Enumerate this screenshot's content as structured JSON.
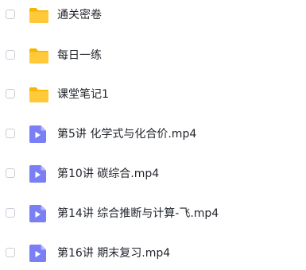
{
  "files": [
    {
      "name": "通关密卷",
      "type": "folder",
      "icon": "folder-icon"
    },
    {
      "name": "每日一练",
      "type": "folder",
      "icon": "folder-icon"
    },
    {
      "name": "课堂笔记1",
      "type": "folder",
      "icon": "folder-icon"
    },
    {
      "name": "第5讲 化学式与化合价.mp4",
      "type": "video",
      "icon": "video-file-icon"
    },
    {
      "name": "第10讲 碳综合.mp4",
      "type": "video",
      "icon": "video-file-icon"
    },
    {
      "name": "第14讲 综合推断与计算-飞.mp4",
      "type": "video",
      "icon": "video-file-icon"
    },
    {
      "name": "第16讲 期末复习.mp4",
      "type": "video",
      "icon": "video-file-icon"
    }
  ],
  "colors": {
    "folder": "#ffc93a",
    "folder_tab": "#f7b500",
    "video_file": "#7b7ff5",
    "video_fold": "#b8baf9",
    "text": "#1f2329",
    "checkbox_border": "#c9ccd4"
  }
}
